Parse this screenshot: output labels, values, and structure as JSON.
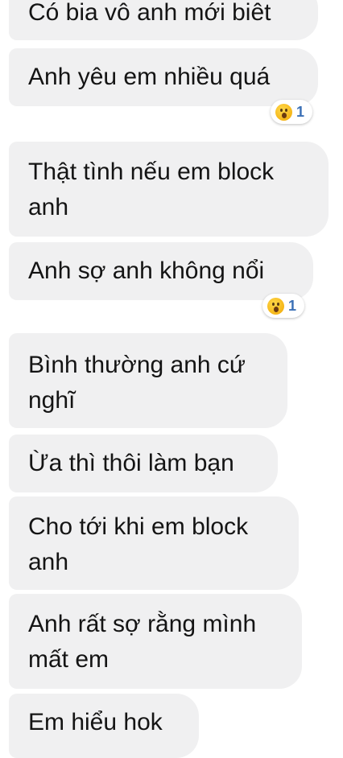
{
  "messages": [
    {
      "text": "Có bia vô anh mới biêt"
    },
    {
      "text": "Anh yêu em nhiều quá",
      "reaction": {
        "icon": "wow-face-icon",
        "count": "1"
      }
    },
    {
      "text": "Thật tình nếu em block anh"
    },
    {
      "text": "Anh sợ anh không nổi",
      "reaction": {
        "icon": "wow-face-icon",
        "count": "1"
      }
    },
    {
      "text": "Bình thường anh cứ nghĩ"
    },
    {
      "text": "Ừa thì thôi làm bạn"
    },
    {
      "text": "Cho tới khi em block anh"
    },
    {
      "text": "Anh rất sợ rằng mình mất em"
    },
    {
      "text": "Em hiểu hok"
    }
  ],
  "colors": {
    "bubble_bg": "#f0f0f1",
    "text": "#141414",
    "reaction_count": "#3b70b6"
  }
}
